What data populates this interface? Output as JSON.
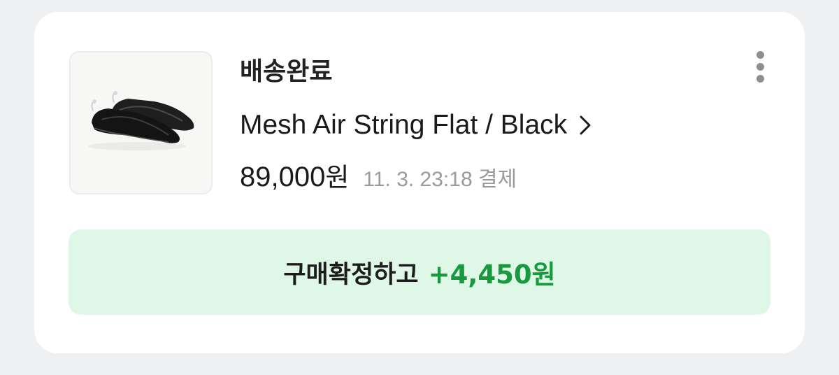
{
  "order": {
    "status": "배송완료",
    "product_name": "Mesh Air String Flat / Black",
    "price": "89,000",
    "price_unit": "원",
    "paid_at": "11. 3. 23:18 결제"
  },
  "action": {
    "label": "구매확정하고",
    "reward": "+4,450원"
  },
  "icons": {
    "more": "more-vertical-icon",
    "chevron": "chevron-right-icon"
  },
  "colors": {
    "background": "#eef0f2",
    "card": "#ffffff",
    "button_bg": "#dff7e6",
    "reward_green": "#169a3d"
  }
}
